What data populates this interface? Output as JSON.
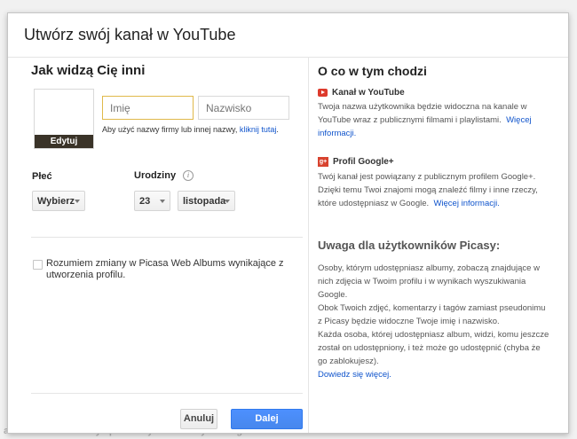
{
  "background_footer": {
    "items": [
      "a autorskie",
      "Twórcy i partnerzy",
      "Reklamy",
      "Programiści"
    ]
  },
  "dialog": {
    "title": "Utwórz swój kanał w YouTube"
  },
  "left": {
    "heading": "Jak widzą Cię inni",
    "photo_edit_label": "Edytuj",
    "first_name_placeholder": "Imię",
    "last_name_placeholder": "Nazwisko",
    "hint_text": "Aby użyć nazwy firmy lub innej nazwy,",
    "hint_link": "kliknij tutaj",
    "hint_end": ".",
    "gender_label": "Płeć",
    "gender_select": "Wybierz",
    "birthday_label": "Urodziny",
    "birthday_day": "23",
    "birthday_month": "listopada",
    "checkbox_label": "Rozumiem zmiany w Picasa Web Albums wynikające z utworzenia profilu.",
    "cancel_button": "Anuluj",
    "ok_button": "Dalej"
  },
  "right": {
    "heading": "O co w tym chodzi",
    "youtube_title": "Kanał w YouTube",
    "youtube_text": "Twoja nazwa użytkownika będzie widoczna na kanale w YouTube wraz z publicznymi filmami i playlistami.",
    "youtube_link": "Więcej informacji.",
    "google_title": "Profil Google+",
    "google_text": "Twój kanał jest powiązany z publicznym profilem Google+. Dzięki temu Twoi znajomi mogą znaleźć filmy i inne rzeczy, które udostępniasz w Google.",
    "google_link": "Więcej informacji.",
    "picasa_heading": "Uwaga dla użytkowników Picasy:",
    "picasa_p1": "Osoby, którym udostępniasz albumy, zobaczą znajdujące w nich zdjęcia w Twoim profilu i w wynikach wyszukiwania Google.",
    "picasa_p2": "Obok Twoich zdjęć, komentarzy i tagów zamiast pseudonimu z Picasy będzie widoczne Twoje imię i nazwisko.",
    "picasa_p3": "Każda osoba, której udostępniasz album, widzi, komu jeszcze został on udostępniony, i też może go udostępnić (chyba że go zablokujesz).",
    "picasa_link": "Dowiedz się więcej."
  },
  "icons": {
    "youtube": "youtube-icon",
    "googleplus": "googleplus-icon",
    "info": "info-icon",
    "caret": "chevron-down-icon"
  },
  "colors": {
    "primary_button": "#4d90fe",
    "link": "#1155cc",
    "focus_border": "#e0b94a",
    "youtube_red": "#dd3a2c"
  }
}
